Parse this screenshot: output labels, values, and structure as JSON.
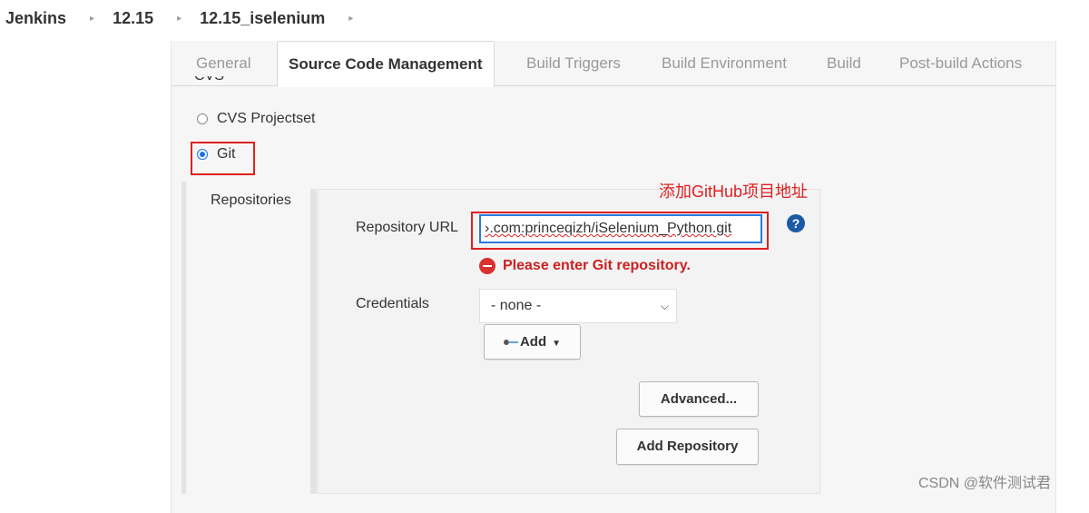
{
  "breadcrumb": {
    "items": [
      "Jenkins",
      "12.15",
      "12.15_iselenium"
    ],
    "separator": "▸"
  },
  "tabs": [
    {
      "label": "General",
      "active": false
    },
    {
      "label": "Source Code Management",
      "active": true
    },
    {
      "label": "Build Triggers",
      "active": false
    },
    {
      "label": "Build Environment",
      "active": false
    },
    {
      "label": "Build",
      "active": false
    },
    {
      "label": "Post-build Actions",
      "active": false
    }
  ],
  "scm": {
    "cut_option_label": "CVS",
    "options": [
      {
        "label": "CVS Projectset",
        "selected": false
      },
      {
        "label": "Git",
        "selected": true
      }
    ]
  },
  "repositories": {
    "section_label": "Repositories",
    "annotation": "添加GitHub项目地址",
    "url_label": "Repository URL",
    "url_value": "›.com:princeqizh/iSelenium_Python.git",
    "help_icon": "question-circle-icon",
    "error_icon": "error-minus-icon",
    "error_text": "Please enter Git repository.",
    "credentials_label": "Credentials",
    "credentials_value": "- none -",
    "add_label": "Add",
    "advanced_label": "Advanced...",
    "add_repository_label": "Add Repository"
  },
  "watermark": "CSDN @软件测试君",
  "colors": {
    "accent": "#2a7ae2",
    "error": "#cc2020",
    "annotation": "#e02020",
    "help": "#1c5aa6"
  }
}
